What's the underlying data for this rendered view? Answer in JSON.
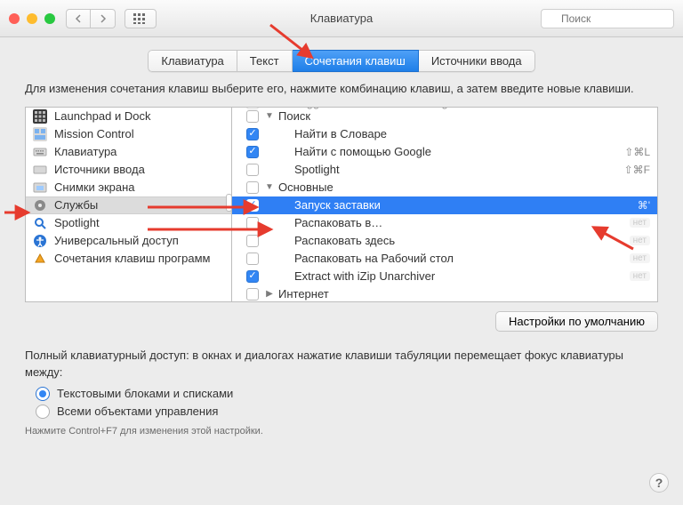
{
  "window": {
    "title": "Клавиатура"
  },
  "search": {
    "placeholder": "Поиск"
  },
  "tabs": [
    {
      "label": "Клавиатура",
      "selected": false
    },
    {
      "label": "Текст",
      "selected": false
    },
    {
      "label": "Сочетания клавиш",
      "selected": true
    },
    {
      "label": "Источники ввода",
      "selected": false
    }
  ],
  "instruction": "Для изменения сочетания клавиш выберите его, нажмите комбинацию клавиш, а затем введите новые клавиши.",
  "categories": [
    {
      "label": "Launchpad и Dock",
      "icon": "launchpad"
    },
    {
      "label": "Mission Control",
      "icon": "mission"
    },
    {
      "label": "Клавиатура",
      "icon": "keyboard"
    },
    {
      "label": "Источники ввода",
      "icon": "input"
    },
    {
      "label": "Снимки экрана",
      "icon": "screenshot"
    },
    {
      "label": "Службы",
      "icon": "gear",
      "selected": true
    },
    {
      "label": "Spotlight",
      "icon": "spotlight"
    },
    {
      "label": "Универсальный доступ",
      "icon": "accessibility"
    },
    {
      "label": "Сочетания клавиш программ",
      "icon": "appshort"
    }
  ],
  "services_cut_top": "Toggle Instruments Recording",
  "groups": [
    {
      "name": "Поиск",
      "checked": false,
      "items": [
        {
          "label": "Найти в Словаре",
          "checked": true,
          "shortcut": ""
        },
        {
          "label": "Найти с помощью Google",
          "checked": true,
          "shortcut": "⇧⌘L"
        },
        {
          "label": "Spotlight",
          "checked": false,
          "shortcut": "⇧⌘F"
        }
      ]
    },
    {
      "name": "Основные",
      "checked": false,
      "items": [
        {
          "label": "Запуск заставки",
          "checked": true,
          "shortcut": "⌘'",
          "selected": true
        },
        {
          "label": "Распаковать в…",
          "checked": false,
          "shortcut": "",
          "none": true
        },
        {
          "label": "Распаковать здесь",
          "checked": false,
          "shortcut": "",
          "none": true
        },
        {
          "label": "Распаковать на Рабочий стол",
          "checked": false,
          "shortcut": "",
          "none": true
        },
        {
          "label": "Extract with iZip Unarchiver",
          "checked": true,
          "shortcut": "",
          "none": true
        }
      ]
    }
  ],
  "group_cut_bottom": "Интернет",
  "restore_defaults": "Настройки по умолчанию",
  "kb_access_text": "Полный клавиатурный доступ: в окнах и диалогах нажатие клавиши табуляции перемещает фокус клавиатуры между:",
  "radios": [
    {
      "label": "Текстовыми блоками и списками",
      "selected": true
    },
    {
      "label": "Всеми объектами управления",
      "selected": false
    }
  ],
  "hint": "Нажмите Control+F7 для изменения этой настройки.",
  "none_badge": "нет"
}
